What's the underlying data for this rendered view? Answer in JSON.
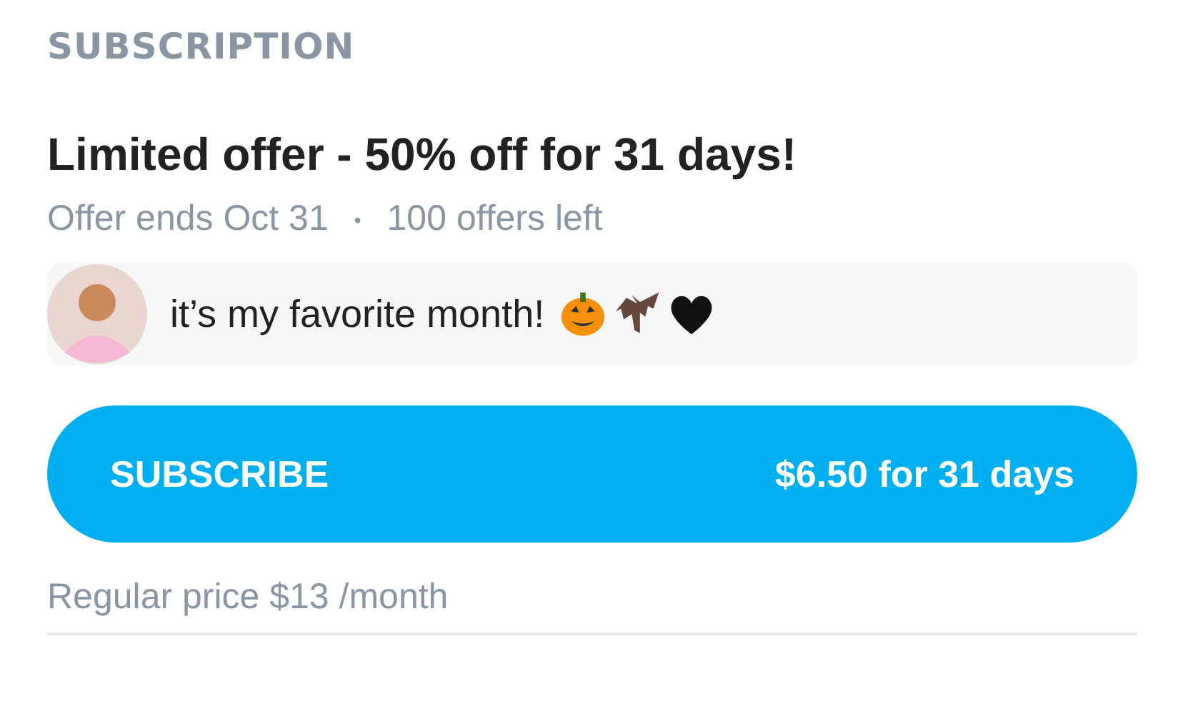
{
  "section_title": "SUBSCRIPTION",
  "offer": {
    "title": "Limited offer - 50% off for 31 days!",
    "ends": "Offer ends Oct 31",
    "separator": "•",
    "offers_left": "100 offers left"
  },
  "message": {
    "text": "it’s my favorite month!"
  },
  "subscribe_button": {
    "label": "SUBSCRIBE",
    "price": "$6.50 for 31 days"
  },
  "regular_price": "Regular price $13 /month"
}
